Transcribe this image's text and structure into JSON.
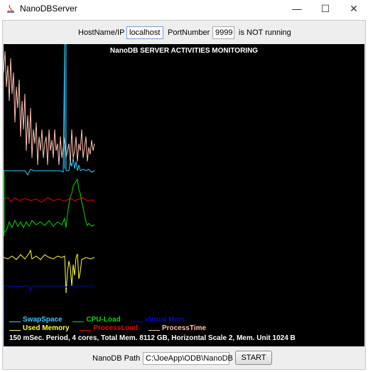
{
  "window": {
    "title": "NanoDBServer",
    "minimize": "—",
    "maximize": "☐",
    "close": "✕"
  },
  "top": {
    "host_label": "HostName/IP",
    "host_value": "localhost",
    "port_label": "PortNumber",
    "port_value": "9999",
    "status": "is NOT running"
  },
  "monitor": {
    "title": "NanoDB SERVER ACTIVITIES MONITORING",
    "legend": [
      {
        "label": "SwapSpace",
        "color": "#33ccff"
      },
      {
        "label": "CPU-Load",
        "color": "#00dd00"
      },
      {
        "label": "Virtual Mem.",
        "color": "#0000ee"
      },
      {
        "label": "Used Memory",
        "color": "#ffff33"
      },
      {
        "label": "ProcessLoad",
        "color": "#ee0000"
      },
      {
        "label": "ProcessTime",
        "color": "#ffc0b0"
      }
    ],
    "info": "150 mSec. Period, 4 cores, Total Mem. 8112 GB, Horizontal Scale 2, Mem. Unit 1024 B"
  },
  "bottom": {
    "path_label": "NanoDB Path",
    "path_value": "C:\\JoeApp\\ODB\\NanoDB",
    "start_label": "START"
  }
}
